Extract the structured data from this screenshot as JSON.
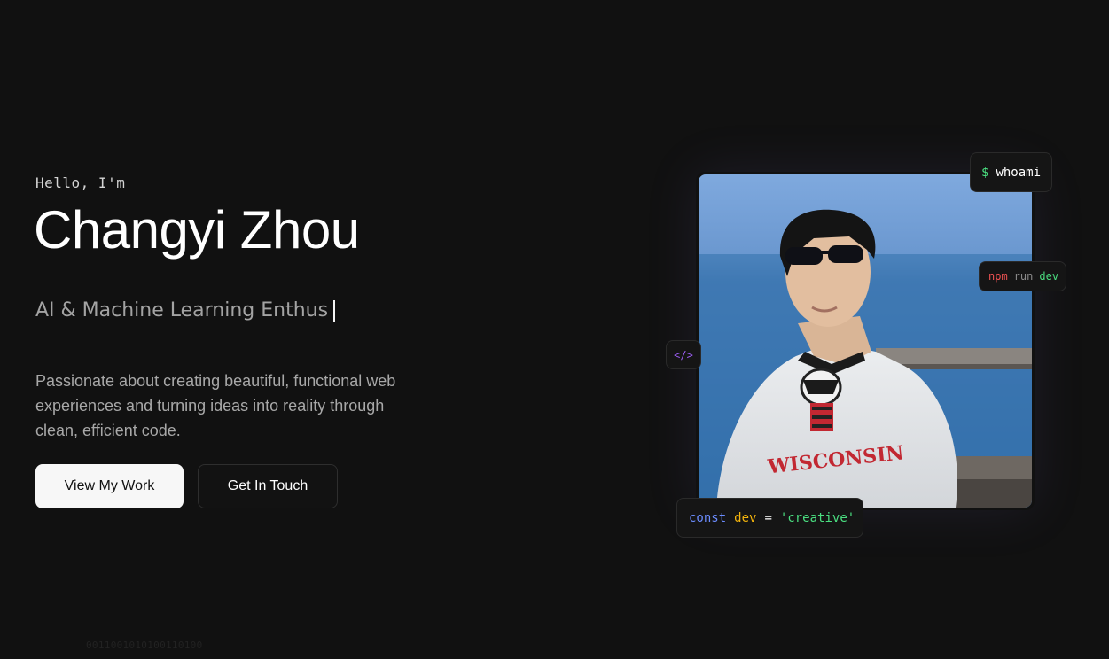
{
  "hero": {
    "greeting": "Hello, I'm",
    "name": "Changyi Zhou",
    "typing_text": "AI & Machine Learning Enthus",
    "description": "Passionate about creating beautiful, functional web experiences and turning ideas into reality through clean, efficient code.",
    "primary_button": "View My Work",
    "secondary_button": "Get In Touch"
  },
  "badges": {
    "whoami": {
      "prompt": "$",
      "command": "whoami"
    },
    "npm": {
      "cmd": "npm",
      "sub": "run",
      "arg": "dev"
    },
    "tag": "</>",
    "code": {
      "keyword": "const",
      "variable": "dev",
      "operator": "=",
      "value": "'creative'"
    }
  },
  "background": {
    "binary": "0011001010100110100"
  },
  "colors": {
    "background": "#111111",
    "prompt_green": "#4ade80",
    "npm_red": "#f05252",
    "keyword_blue": "#6b8cff",
    "variable_yellow": "#f5b50c",
    "tag_purple": "#9a5cf0"
  },
  "icons": {
    "code_tag": "code-brackets-icon"
  }
}
